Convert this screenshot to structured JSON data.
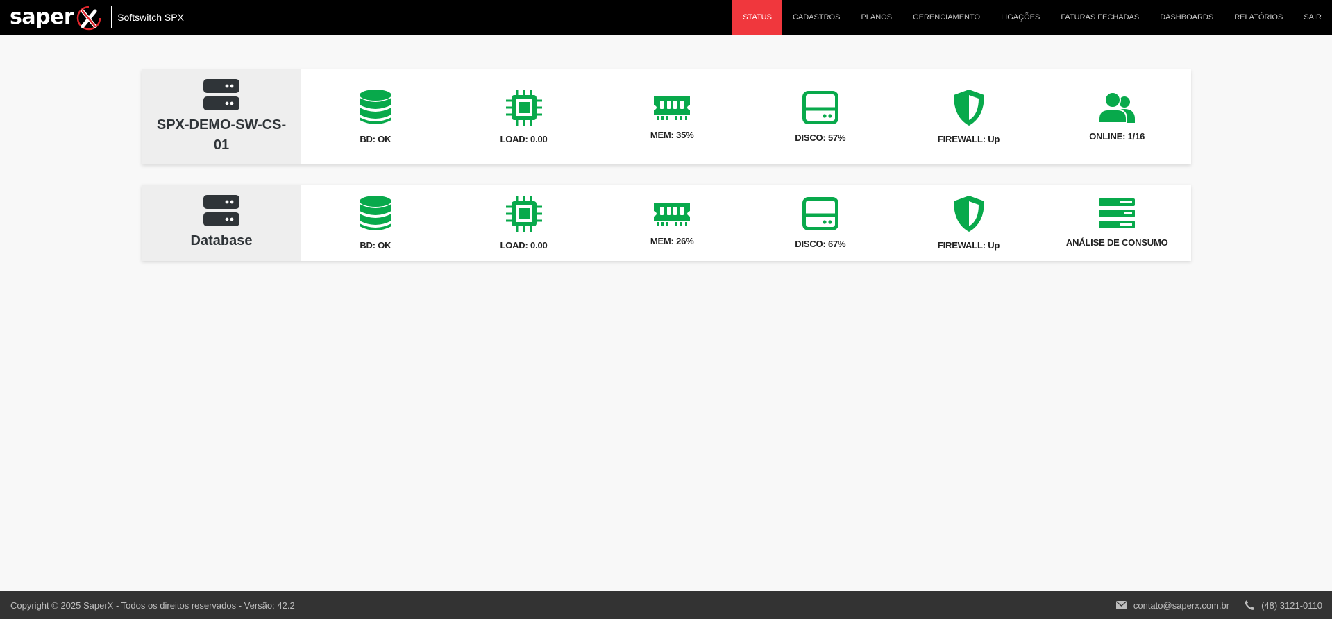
{
  "brand": {
    "logo_text": "saper",
    "app_title": "Softswitch SPX",
    "accent_color": "#f0373d"
  },
  "nav": {
    "items": [
      {
        "label": "STATUS",
        "active": true
      },
      {
        "label": "CADASTROS"
      },
      {
        "label": "PLANOS"
      },
      {
        "label": "GERENCIAMENTO"
      },
      {
        "label": "LIGAÇÕES"
      },
      {
        "label": "FATURAS FECHADAS"
      },
      {
        "label": "DASHBOARDS"
      },
      {
        "label": "RELATÓRIOS"
      },
      {
        "label": "SAIR"
      }
    ]
  },
  "servers": [
    {
      "name": "SPX-DEMO-SW-CS-01",
      "icon": "server-icon",
      "metrics": [
        {
          "icon": "database-icon",
          "label": "BD: OK"
        },
        {
          "icon": "cpu-icon",
          "label": "LOAD: 0.00"
        },
        {
          "icon": "memory-icon",
          "label": "MEM: 35%"
        },
        {
          "icon": "hdd-icon",
          "label": "DISCO: 57%"
        },
        {
          "icon": "shield-icon",
          "label": "FIREWALL: Up"
        },
        {
          "icon": "users-icon",
          "label": "ONLINE: 1/16"
        }
      ]
    },
    {
      "name": "Database",
      "icon": "server-icon",
      "metrics": [
        {
          "icon": "database-icon",
          "label": "BD: OK"
        },
        {
          "icon": "cpu-icon",
          "label": "LOAD: 0.00"
        },
        {
          "icon": "memory-icon",
          "label": "MEM: 26%"
        },
        {
          "icon": "hdd-icon",
          "label": "DISCO: 67%"
        },
        {
          "icon": "shield-icon",
          "label": "FIREWALL: Up"
        },
        {
          "icon": "stream-icon",
          "label": "ANÁLISE DE CONSUMO"
        }
      ]
    }
  ],
  "status_color": "#08a94b",
  "footer": {
    "copyright": "Copyright © 2025 SaperX - Todos os direitos reservados - Versão: 42.2",
    "email": "contato@saperx.com.br",
    "phone": "(48) 3121-0110"
  }
}
